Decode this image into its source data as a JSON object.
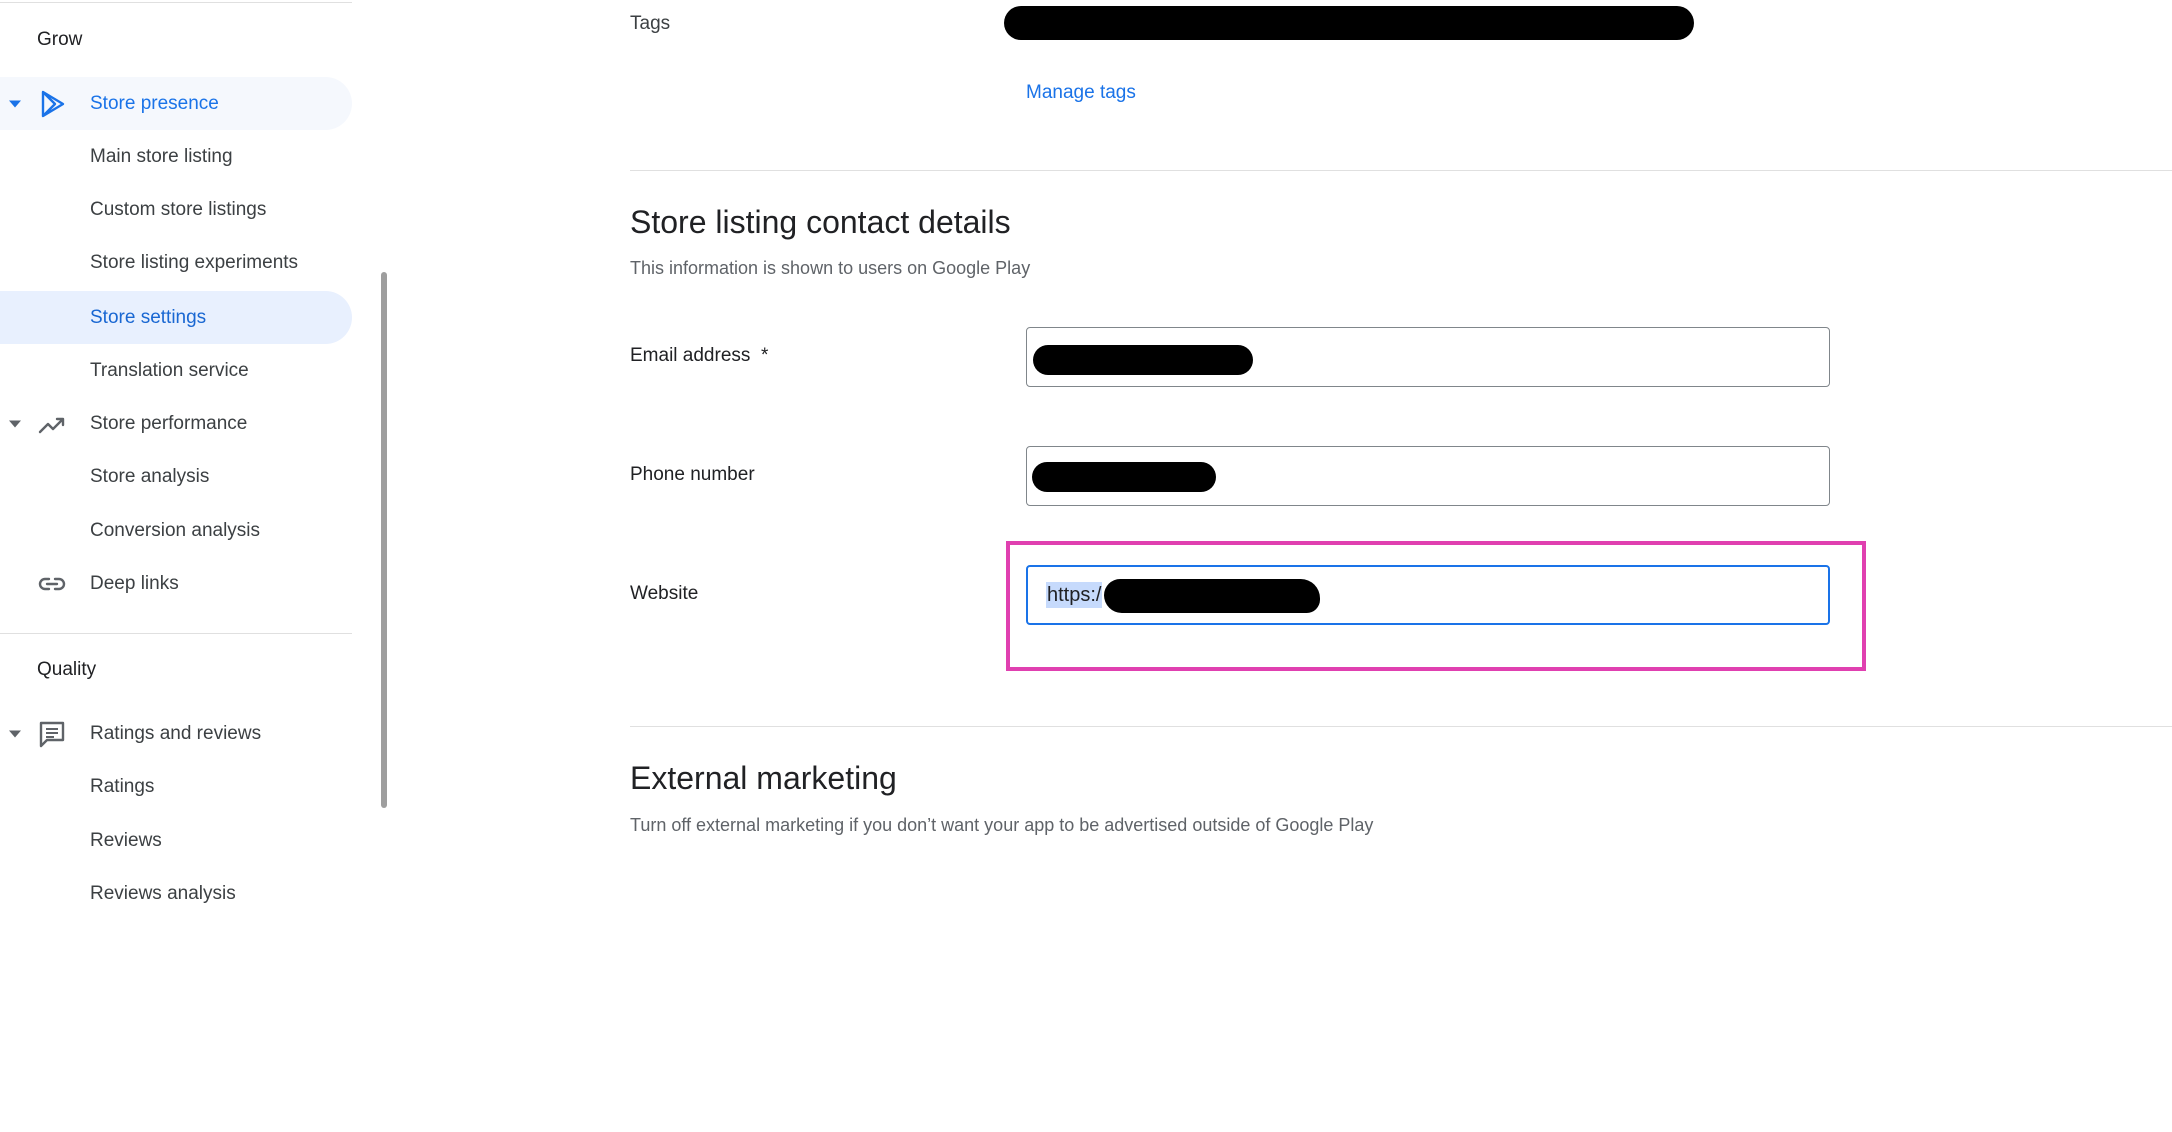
{
  "sidebar": {
    "grow_label": "Grow",
    "quality_label": "Quality",
    "store_presence": "Store presence",
    "main_store_listing": "Main store listing",
    "custom_store_listings": "Custom store listings",
    "store_listing_experiments": "Store listing experiments",
    "store_settings": "Store settings",
    "translation_service": "Translation service",
    "store_performance": "Store performance",
    "store_analysis": "Store analysis",
    "conversion_analysis": "Conversion analysis",
    "deep_links": "Deep links",
    "ratings_and_reviews": "Ratings and reviews",
    "ratings": "Ratings",
    "reviews": "Reviews",
    "reviews_analysis": "Reviews analysis"
  },
  "main": {
    "tags_label": "Tags",
    "manage_tags": "Manage tags",
    "contact_title": "Store listing contact details",
    "contact_desc": "This information is shown to users on Google Play",
    "email_label": "Email address  *",
    "phone_label": "Phone number",
    "website_label": "Website",
    "website_value": "https:/",
    "external_title": "External marketing",
    "external_desc": "Turn off external marketing if you don’t want your app to be advertised outside of Google Play"
  },
  "colors": {
    "accent": "#1a73e8",
    "selected_bg": "#e8f0fe",
    "highlight_border": "#e040b0"
  },
  "icons": {
    "store_presence": "play-triangle-icon",
    "store_performance": "trending-up-icon",
    "deep_links": "link-icon",
    "ratings_and_reviews": "comment-icon"
  }
}
